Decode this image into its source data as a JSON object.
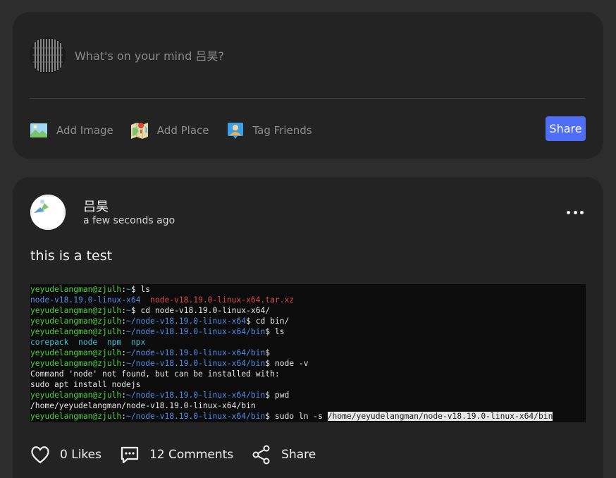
{
  "composer": {
    "placeholder": "What's on your mind 吕昊?",
    "actions": [
      {
        "label": "Add Image",
        "icon": "image-icon"
      },
      {
        "label": "Add Place",
        "icon": "map-icon"
      },
      {
        "label": "Tag Friends",
        "icon": "tag-friends-icon"
      }
    ],
    "share_label": "Share",
    "accent": "#4f6ef5"
  },
  "post": {
    "author": "吕昊",
    "time": "a few seconds ago",
    "text": "this is a test",
    "terminal": [
      [
        {
          "t": "yeyudelangman@zjulh",
          "c": "u"
        },
        {
          "t": ":",
          "c": "c"
        },
        {
          "t": "~",
          "c": "p"
        },
        {
          "t": "$ ls",
          "c": "w"
        }
      ],
      [
        {
          "t": "node-v18.19.0-linux-x64",
          "c": "b"
        },
        {
          "t": "  ",
          "c": "w"
        },
        {
          "t": "node-v18.19.0-linux-x64.tar.xz",
          "c": "r"
        }
      ],
      [
        {
          "t": "yeyudelangman@zjulh",
          "c": "u"
        },
        {
          "t": ":",
          "c": "c"
        },
        {
          "t": "~",
          "c": "p"
        },
        {
          "t": "$ cd node-v18.19.0-linux-x64/",
          "c": "w"
        }
      ],
      [
        {
          "t": "yeyudelangman@zjulh",
          "c": "u"
        },
        {
          "t": ":",
          "c": "c"
        },
        {
          "t": "~/node-v18.19.0-linux-x64",
          "c": "p"
        },
        {
          "t": "$ cd bin/",
          "c": "w"
        }
      ],
      [
        {
          "t": "yeyudelangman@zjulh",
          "c": "u"
        },
        {
          "t": ":",
          "c": "c"
        },
        {
          "t": "~/node-v18.19.0-linux-x64/bin",
          "c": "p"
        },
        {
          "t": "$ ls",
          "c": "w"
        }
      ],
      [
        {
          "t": "corepack",
          "c": "cy"
        },
        {
          "t": "  ",
          "c": "w"
        },
        {
          "t": "node",
          "c": "cy"
        },
        {
          "t": "  ",
          "c": "w"
        },
        {
          "t": "npm",
          "c": "cy"
        },
        {
          "t": "  ",
          "c": "w"
        },
        {
          "t": "npx",
          "c": "cy"
        }
      ],
      [
        {
          "t": "yeyudelangman@zjulh",
          "c": "u"
        },
        {
          "t": ":",
          "c": "c"
        },
        {
          "t": "~/node-v18.19.0-linux-x64/bin",
          "c": "p"
        },
        {
          "t": "$",
          "c": "w"
        }
      ],
      [
        {
          "t": "yeyudelangman@zjulh",
          "c": "u"
        },
        {
          "t": ":",
          "c": "c"
        },
        {
          "t": "~/node-v18.19.0-linux-x64/bin",
          "c": "p"
        },
        {
          "t": "$ node -v",
          "c": "w"
        }
      ],
      [
        {
          "t": "Command 'node' not found, but can be installed with:",
          "c": "w"
        }
      ],
      [
        {
          "t": "sudo apt install nodejs",
          "c": "w"
        }
      ],
      [
        {
          "t": "yeyudelangman@zjulh",
          "c": "u"
        },
        {
          "t": ":",
          "c": "c"
        },
        {
          "t": "~/node-v18.19.0-linux-x64/bin",
          "c": "p"
        },
        {
          "t": "$ pwd",
          "c": "w"
        }
      ],
      [
        {
          "t": "/home/yeyudelangman/node-v18.19.0-linux-x64/bin",
          "c": "w"
        }
      ],
      [
        {
          "t": "yeyudelangman@zjulh",
          "c": "u"
        },
        {
          "t": ":",
          "c": "c"
        },
        {
          "t": "~/node-v18.19.0-linux-x64/bin",
          "c": "p"
        },
        {
          "t": "$ sudo ln -s ",
          "c": "w"
        },
        {
          "t": "/home/yeyudelangman/node-v18.19.0-linux-x64/bin",
          "c": "sel"
        }
      ]
    ],
    "likes_label": "0 Likes",
    "comments_label": "12 Comments",
    "share_label": "Share"
  }
}
